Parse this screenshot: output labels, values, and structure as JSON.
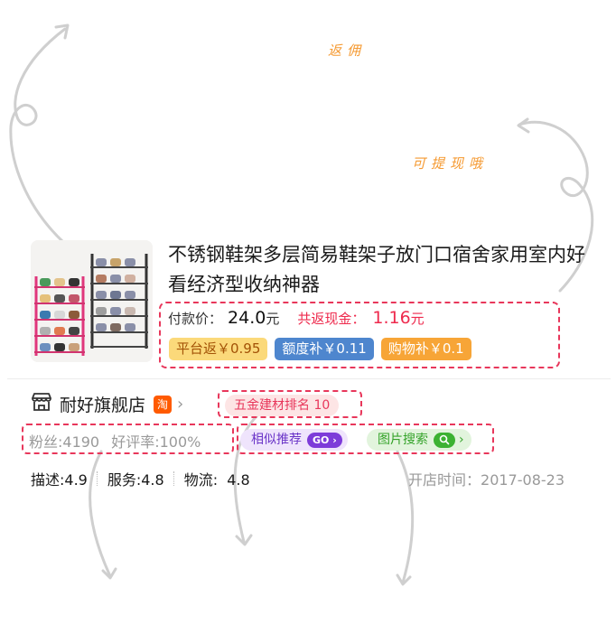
{
  "annotations": {
    "rebate": "返佣",
    "withdrawable": "可提现哦"
  },
  "product": {
    "title": "不锈钢鞋架多层简易鞋架子放门口宿舍家用室内好看经济型收纳神器",
    "pay_label": "付款价：",
    "pay_value": "24.0",
    "pay_unit": "元",
    "rebate_label": "共返现金：",
    "rebate_value": "1.16",
    "rebate_unit": "元",
    "tags": [
      "平台返￥0.95",
      "额度补￥0.11",
      "购物补￥0.1"
    ]
  },
  "store": {
    "name": "耐好旗舰店",
    "platform_badge": "淘",
    "rank_label": "五金建材排名 10",
    "fans": "粉丝:4190",
    "good_rate": "好评率:100%",
    "similar_label": "相似推荐",
    "similar_go": "GO",
    "image_search_label": "图片搜索",
    "scores": [
      {
        "label": "描述:4.9"
      },
      {
        "label": "服务:4.8"
      },
      {
        "label": "物流:  4.8"
      }
    ],
    "open_label": "开店时间：",
    "open_date": "2017-08-23"
  },
  "colors": {
    "annotation_orange": "#f59a32",
    "dashed_red": "#e8375b",
    "price_red": "#ee2a4d",
    "tag_yellow": "#fbd97a",
    "tag_blue": "#4e86ce",
    "tag_orange": "#f7a537"
  },
  "icons": {
    "store": "store-icon",
    "chevron": "chevron-right-icon",
    "search": "search-icon"
  }
}
